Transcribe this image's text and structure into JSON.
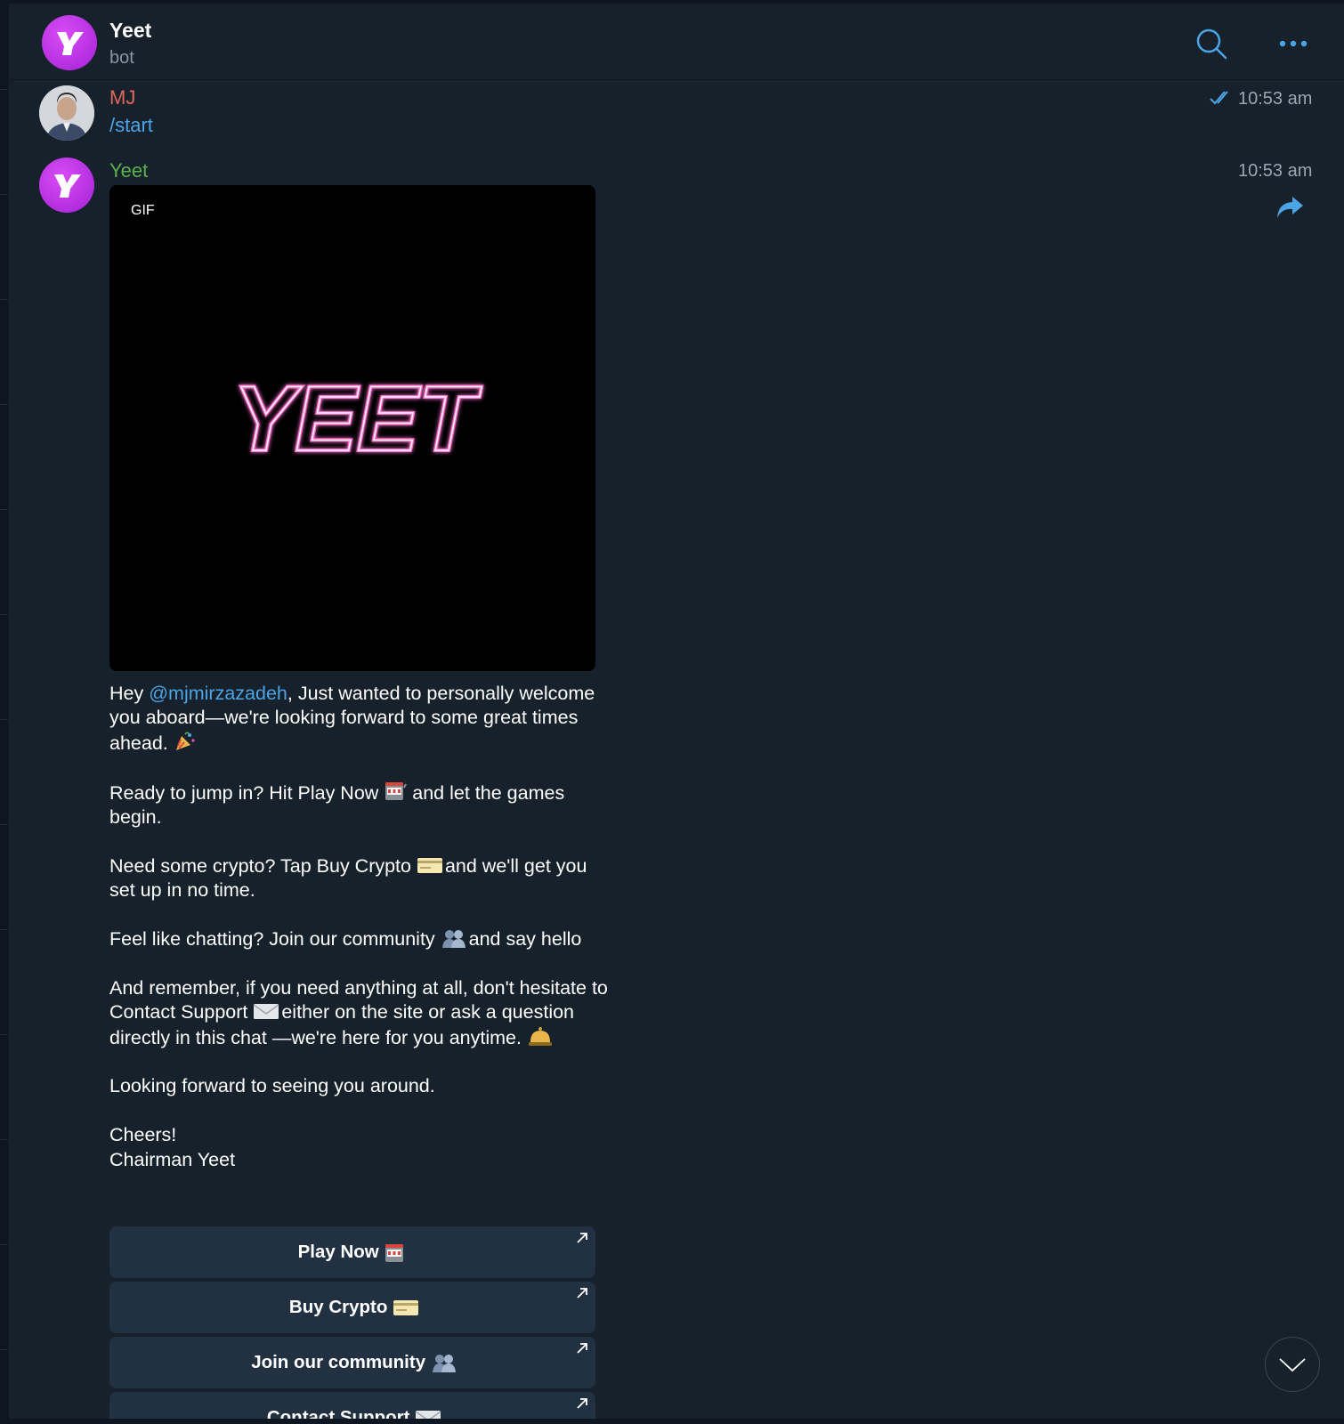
{
  "header": {
    "title": "Yeet",
    "subtitle": "bot",
    "avatar_letter": "Y",
    "icons": [
      "search-icon",
      "more-icon"
    ]
  },
  "messages": [
    {
      "sender": "MJ",
      "text": "/start",
      "time": "10:53 am",
      "status": "read",
      "sender_color": "#e0685c"
    },
    {
      "sender": "Yeet",
      "time": "10:53 am",
      "sender_color": "#59b150",
      "gif_badge": "GIF",
      "gif_logo": "YEET",
      "paragraphs": [
        {
          "prefix": "Hey ",
          "mention": "@mjmirzazadeh",
          "rest": ", Just wanted to personally welcome you aboard—we're looking forward to some great times ahead. ",
          "emoji": "party-popper-emoji"
        },
        {
          "prefix": "Ready to jump in? Hit Play Now ",
          "emoji": "slot-machine-emoji",
          "rest": " and let the games begin."
        },
        {
          "prefix": "Need some crypto? Tap Buy Crypto ",
          "emoji": "credit-card-emoji",
          "rest": " and we'll get you set up in no time."
        },
        {
          "prefix": "Feel like chatting? Join our community ",
          "emoji": "people-emoji",
          "rest": " and say hello"
        },
        {
          "prefix": "And remember, if you need anything at all, don't hesitate to Contact Support ",
          "emoji": "envelope-emoji",
          "rest": " either on the site or ask a question directly in this chat —we're here for you anytime. ",
          "emoji2": "bell-emoji"
        },
        {
          "prefix": "Looking forward to seeing you around."
        },
        {
          "line1": "Cheers!",
          "line2": "Chairman Yeet"
        }
      ],
      "buttons": [
        {
          "label": "Play Now",
          "emoji": "slot-machine-emoji"
        },
        {
          "label": "Buy Crypto",
          "emoji": "credit-card-emoji"
        },
        {
          "label": "Join our community",
          "emoji": "people-emoji"
        },
        {
          "label": "Contact Support",
          "emoji": "envelope-emoji"
        }
      ]
    }
  ],
  "colors": {
    "background": "#17212b",
    "accent": "#4ba4e6",
    "button_bg": "#223142",
    "avatar_purple": "#b32ee0"
  }
}
